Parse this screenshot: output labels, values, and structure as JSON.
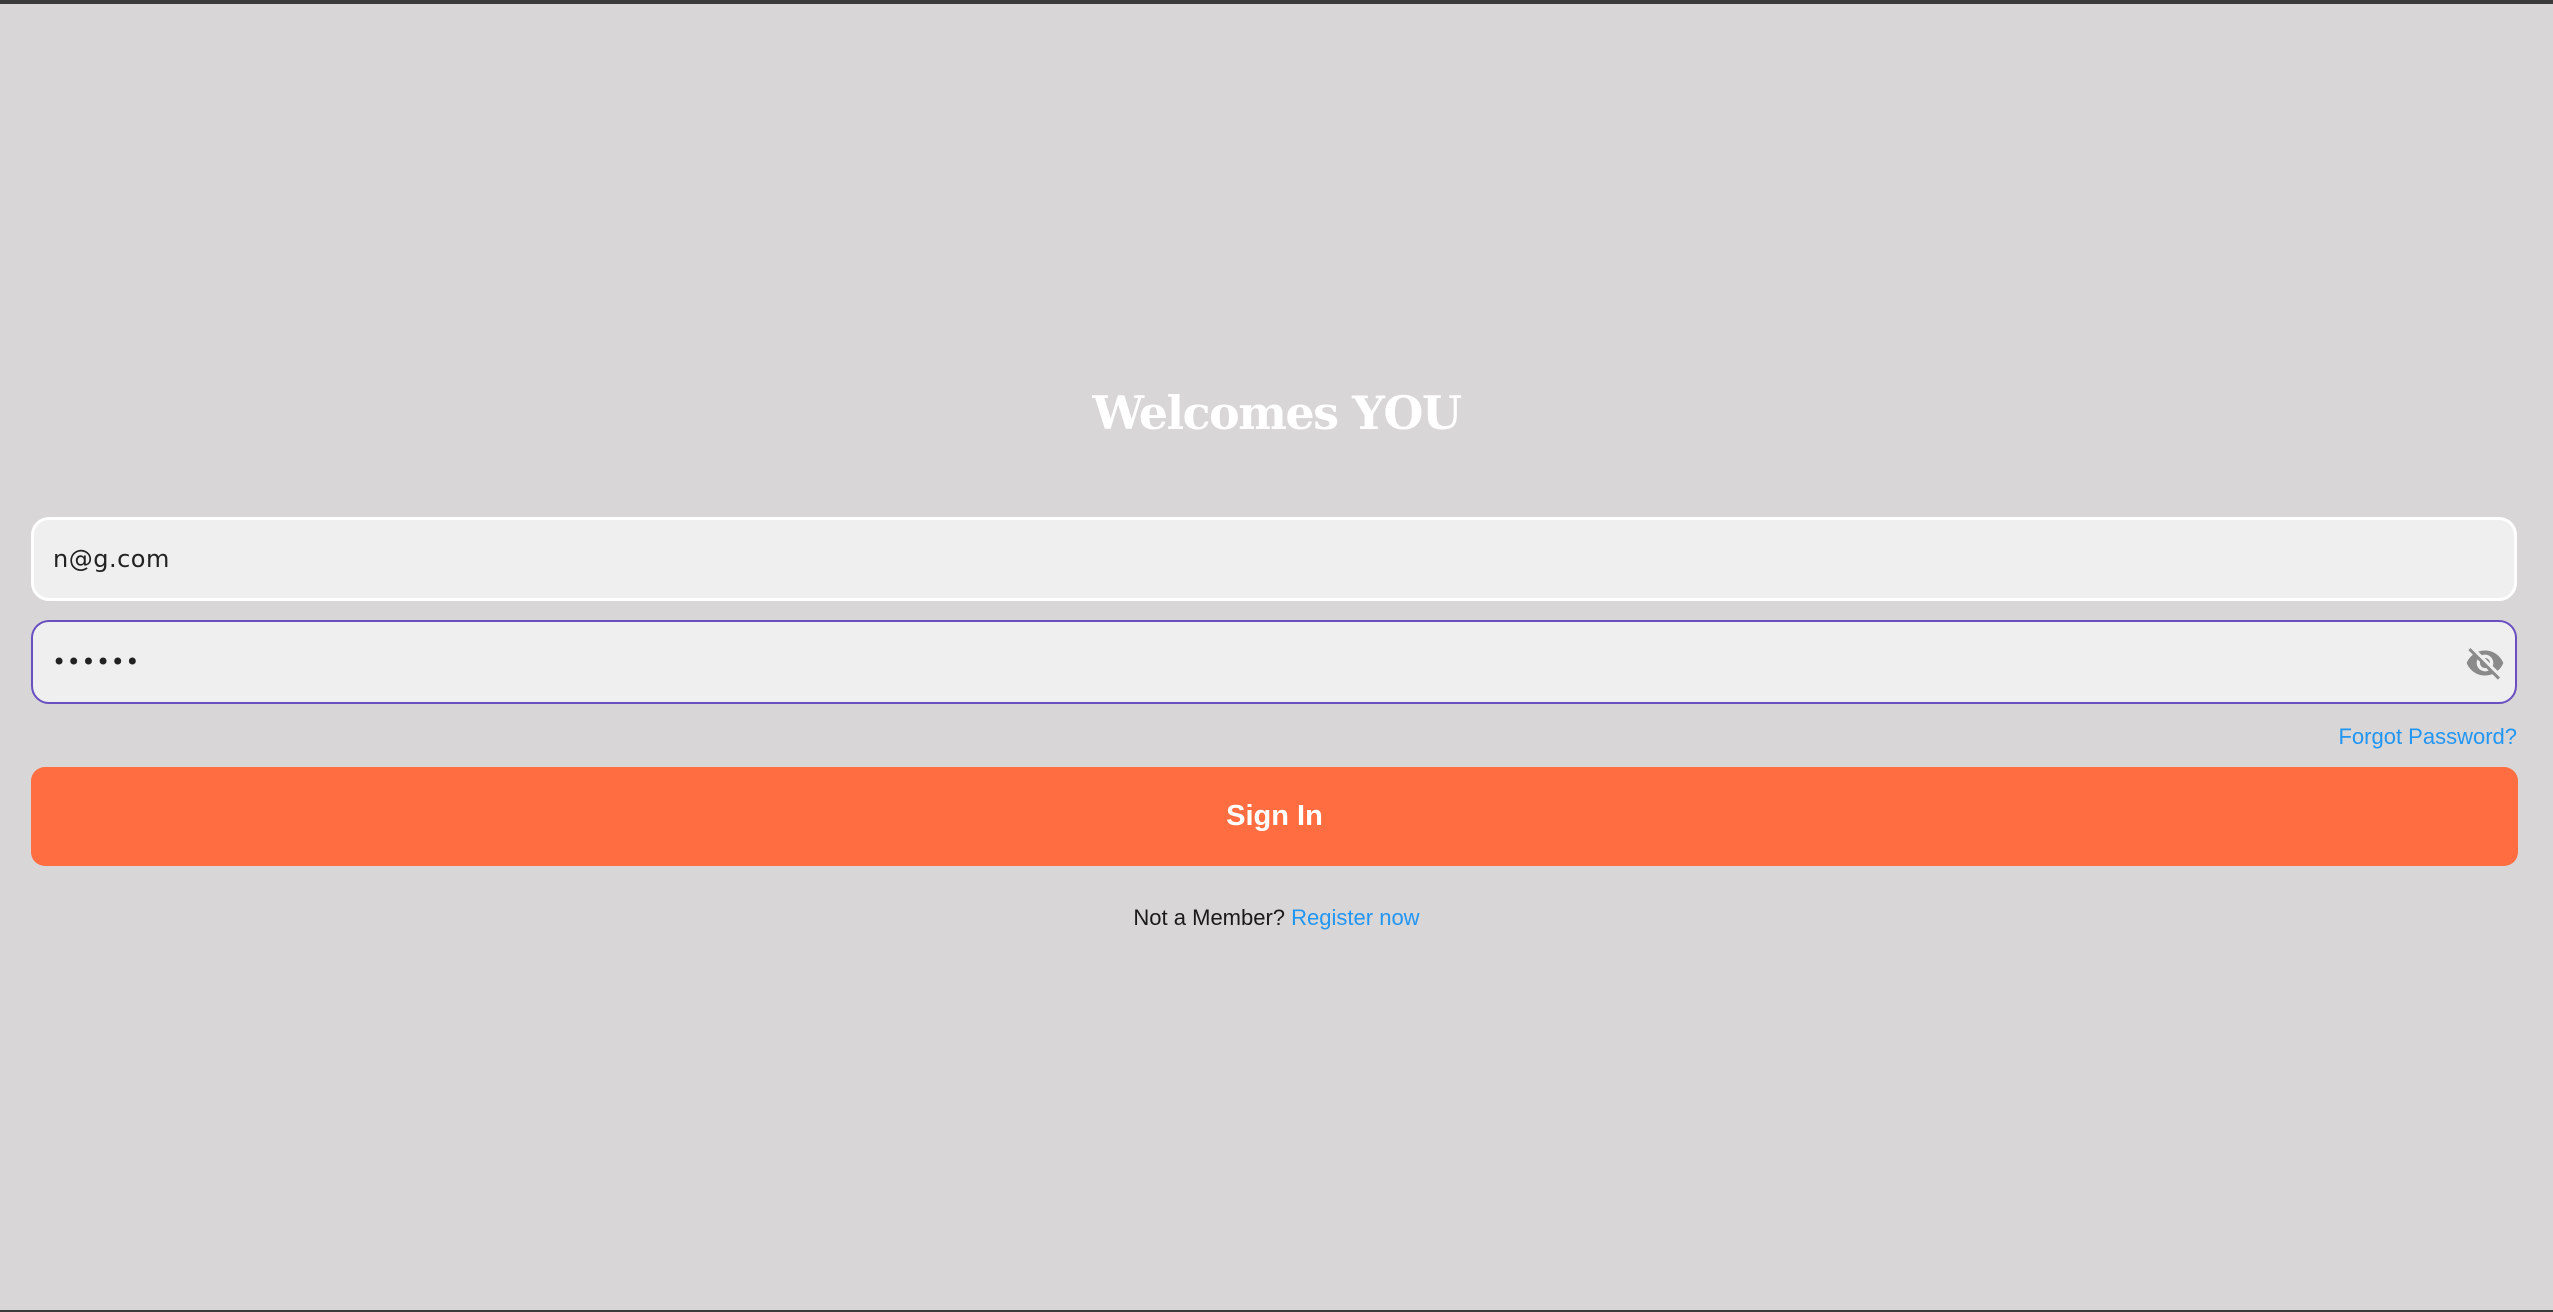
{
  "header": {
    "title": "Welcomes YOU"
  },
  "form": {
    "email_value": "n@g.com",
    "password_value": "••••••",
    "password_visibility_icon": "eye-off-icon",
    "forgot_label": "Forgot Password?",
    "sign_in_label": "Sign In"
  },
  "footer": {
    "prompt": "Not a Member?",
    "register_label": "Register now"
  },
  "colors": {
    "background": "#d8d6d7",
    "accent": "#ff6d41",
    "link": "#2196f3",
    "focus_border": "#6a4fc0"
  }
}
